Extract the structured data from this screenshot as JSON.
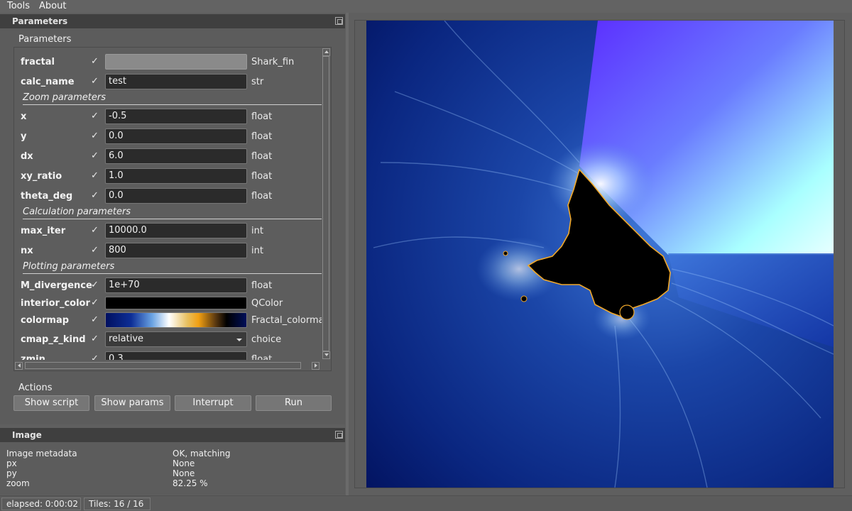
{
  "menu": {
    "items": [
      "Tools",
      "About"
    ]
  },
  "params_dock": {
    "title": "Parameters",
    "group_label": "Parameters"
  },
  "params": {
    "rows": [
      {
        "name": "fractal",
        "check": "✓",
        "value": "",
        "type": "Shark_fin"
      },
      {
        "name": "calc_name",
        "check": "✓",
        "value": "test",
        "type": "str"
      },
      {
        "name": "x",
        "check": "✓",
        "value": "-0.5",
        "type": "float"
      },
      {
        "name": "y",
        "check": "✓",
        "value": "0.0",
        "type": "float"
      },
      {
        "name": "dx",
        "check": "✓",
        "value": "6.0",
        "type": "float"
      },
      {
        "name": "xy_ratio",
        "check": "✓",
        "value": "1.0",
        "type": "float"
      },
      {
        "name": "theta_deg",
        "check": "✓",
        "value": "0.0",
        "type": "float"
      },
      {
        "name": "max_iter",
        "check": "✓",
        "value": "10000.0",
        "type": "int"
      },
      {
        "name": "nx",
        "check": "✓",
        "value": "800",
        "type": "int"
      },
      {
        "name": "M_divergence",
        "check": "✓",
        "value": "1e+70",
        "type": "float"
      },
      {
        "name": "interior_color",
        "check": "✓",
        "value": "",
        "type": "QColor"
      },
      {
        "name": "colormap",
        "check": "✓",
        "value": "",
        "type": "Fractal_colormap"
      },
      {
        "name": "cmap_z_kind",
        "check": "✓",
        "value": "relative",
        "type": "choice"
      },
      {
        "name": "zmin",
        "check": "✓",
        "value": "0.3",
        "type": "float"
      }
    ],
    "sections": [
      "Zoom parameters",
      "Calculation parameters",
      "Plotting parameters"
    ]
  },
  "actions": {
    "label": "Actions",
    "buttons": [
      "Show script",
      "Show params",
      "Interrupt",
      "Run"
    ]
  },
  "image_dock": {
    "title": "Image",
    "rows": [
      {
        "key": "Image metadata",
        "value": "OK, matching"
      },
      {
        "key": "px",
        "value": "None"
      },
      {
        "key": "py",
        "value": "None"
      },
      {
        "key": "zoom",
        "value": "82.25 %"
      }
    ]
  },
  "status": {
    "elapsed": "elapsed: 0:00:02",
    "tiles": "Tiles: 16 / 16"
  },
  "colors": {
    "dock_title_bg": "#3f3f3f",
    "field_bg": "#2b2b2b",
    "deep_blue": "#021060",
    "accent_violet": "#5c2cff",
    "interior_black": "#000000"
  }
}
